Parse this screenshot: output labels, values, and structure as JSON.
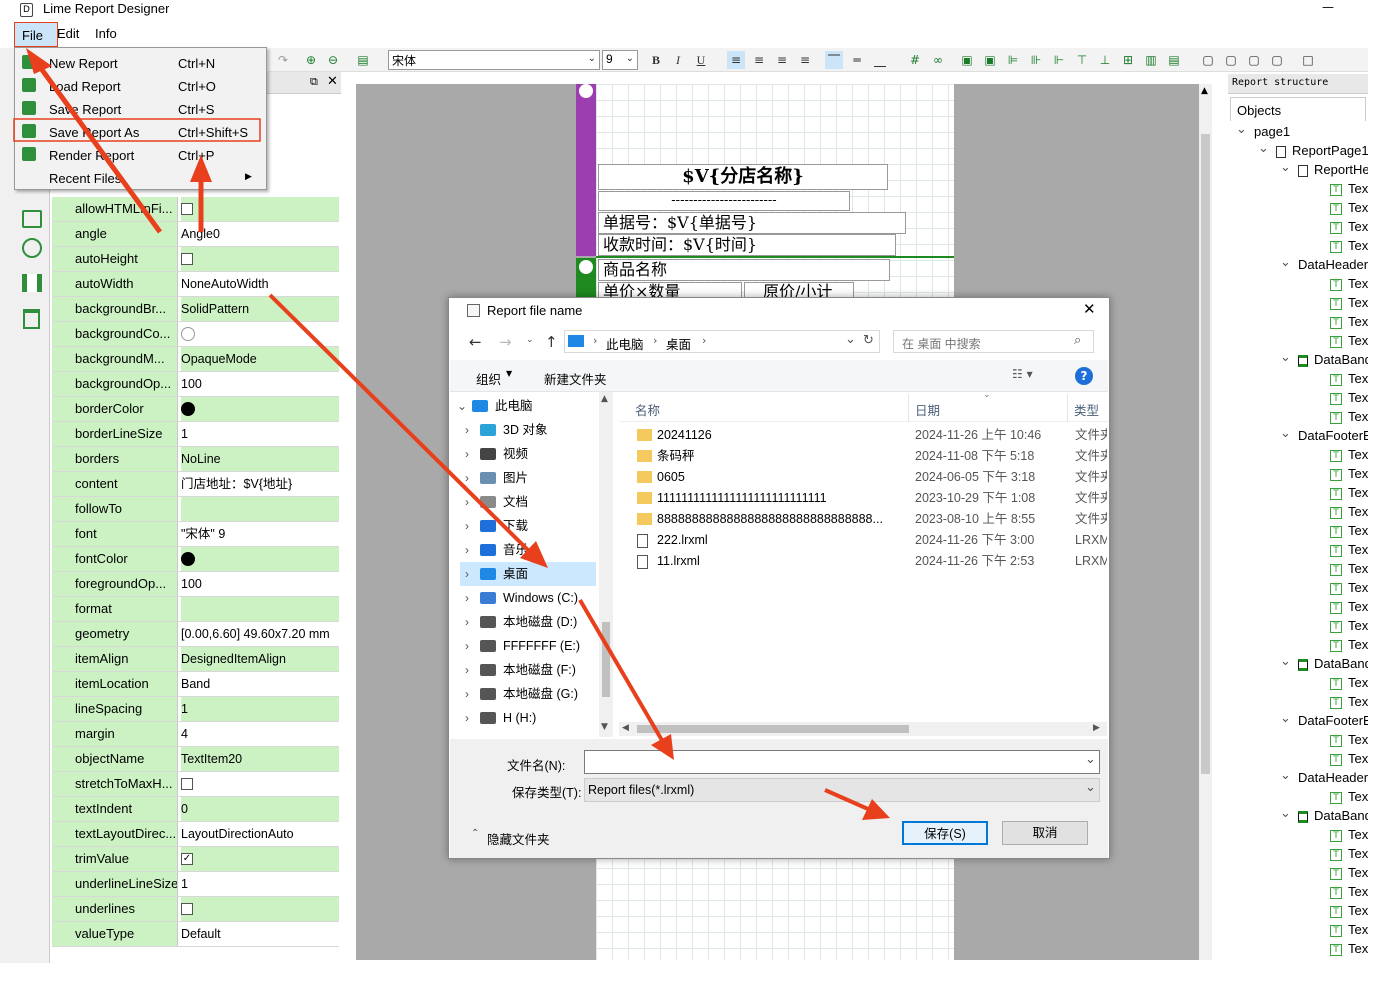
{
  "window": {
    "title": "Lime Report Designer",
    "close_glyph": "✕",
    "min_glyph": "—"
  },
  "menubar": {
    "items": [
      "File",
      "Edit",
      "Info"
    ]
  },
  "toolbar": {
    "font_family": "宋体",
    "font_size": "9",
    "bold": "B",
    "italic": "I",
    "underline": "U"
  },
  "file_menu": {
    "items": [
      {
        "label": "New Report",
        "shortcut": "Ctrl+N"
      },
      {
        "label": "Load Report",
        "shortcut": "Ctrl+O"
      },
      {
        "label": "Save Report",
        "shortcut": "Ctrl+S"
      },
      {
        "label": "Save Report As",
        "shortcut": "Ctrl+Shift+S"
      },
      {
        "label": "Render Report",
        "shortcut": "Ctrl+P"
      },
      {
        "label": "Recent Files",
        "shortcut": ""
      }
    ]
  },
  "properties": [
    {
      "name": "allowHTMLInFi...",
      "value": "",
      "kind": "check",
      "checked": false
    },
    {
      "name": "angle",
      "value": "Angle0",
      "kind": "text"
    },
    {
      "name": "autoHeight",
      "value": "",
      "kind": "check",
      "checked": false
    },
    {
      "name": "autoWidth",
      "value": "NoneAutoWidth",
      "kind": "text"
    },
    {
      "name": "backgroundBr...",
      "value": "SolidPattern",
      "kind": "text"
    },
    {
      "name": "backgroundCo...",
      "value": "",
      "kind": "circle",
      "color": "#ffffff"
    },
    {
      "name": "backgroundM...",
      "value": "OpaqueMode",
      "kind": "text"
    },
    {
      "name": "backgroundOp...",
      "value": "100",
      "kind": "text"
    },
    {
      "name": "borderColor",
      "value": "",
      "kind": "circle",
      "color": "#000000"
    },
    {
      "name": "borderLineSize",
      "value": "1",
      "kind": "text"
    },
    {
      "name": "borders",
      "value": "NoLine",
      "kind": "text",
      "expandable": true
    },
    {
      "name": "content",
      "value": "门店地址：$V{地址}",
      "kind": "text"
    },
    {
      "name": "followTo",
      "value": "",
      "kind": "text"
    },
    {
      "name": "font",
      "value": "\"宋体\" 9",
      "kind": "text",
      "expandable": true
    },
    {
      "name": "fontColor",
      "value": "",
      "kind": "circle",
      "color": "#000000"
    },
    {
      "name": "foregroundOp...",
      "value": "100",
      "kind": "text"
    },
    {
      "name": "format",
      "value": "",
      "kind": "text"
    },
    {
      "name": "geometry",
      "value": "[0.00,6.60] 49.60x7.20 mm",
      "kind": "text",
      "expandable": true
    },
    {
      "name": "itemAlign",
      "value": "DesignedItemAlign",
      "kind": "text"
    },
    {
      "name": "itemLocation",
      "value": "Band",
      "kind": "text"
    },
    {
      "name": "lineSpacing",
      "value": "1",
      "kind": "text"
    },
    {
      "name": "margin",
      "value": "4",
      "kind": "text"
    },
    {
      "name": "objectName",
      "value": "TextItem20",
      "kind": "text"
    },
    {
      "name": "stretchToMaxH...",
      "value": "",
      "kind": "check",
      "checked": false
    },
    {
      "name": "textIndent",
      "value": "0",
      "kind": "text"
    },
    {
      "name": "textLayoutDirec...",
      "value": "LayoutDirectionAuto",
      "kind": "text"
    },
    {
      "name": "trimValue",
      "value": "",
      "kind": "check",
      "checked": true
    },
    {
      "name": "underlineLineSize",
      "value": "1",
      "kind": "text"
    },
    {
      "name": "underlines",
      "value": "",
      "kind": "check",
      "checked": false
    },
    {
      "name": "valueType",
      "value": "Default",
      "kind": "text"
    }
  ],
  "report_page": {
    "title_field": "$V{分店名称}",
    "dashes": "------------------------",
    "order_no": "单据号：$V{单据号}",
    "pay_time": "收款时间：$V{时间}",
    "product_name": "商品名称",
    "unit_price": "单价×数量",
    "orig_price": "原价/小计"
  },
  "structure": {
    "header": "Report structure",
    "objects_label": "Objects",
    "nodes": [
      {
        "label": "page1",
        "level": 0,
        "arrow": true,
        "icon": "none"
      },
      {
        "label": "ReportPage1",
        "level": 1,
        "arrow": true,
        "icon": "page"
      },
      {
        "label": "ReportHeader",
        "level": 2,
        "arrow": true,
        "icon": "page"
      },
      {
        "label": "TextItem",
        "level": 3,
        "icon": "T"
      },
      {
        "label": "TextItem",
        "level": 3,
        "icon": "T"
      },
      {
        "label": "TextItem",
        "level": 3,
        "icon": "T"
      },
      {
        "label": "TextItem",
        "level": 3,
        "icon": "T"
      },
      {
        "label": "DataHeaderBand",
        "level": 2,
        "arrow": true,
        "icon": "none"
      },
      {
        "label": "TextItem",
        "level": 3,
        "icon": "T"
      },
      {
        "label": "TextItem",
        "level": 3,
        "icon": "T"
      },
      {
        "label": "TextItem",
        "level": 3,
        "icon": "T"
      },
      {
        "label": "TextItem",
        "level": 3,
        "icon": "T"
      },
      {
        "label": "DataBand",
        "level": 2,
        "arrow": true,
        "icon": "band"
      },
      {
        "label": "TextItem",
        "level": 3,
        "icon": "T"
      },
      {
        "label": "TextItem",
        "level": 3,
        "icon": "T"
      },
      {
        "label": "TextItem",
        "level": 3,
        "icon": "T"
      },
      {
        "label": "DataFooterBand",
        "level": 2,
        "arrow": true,
        "icon": "none"
      },
      {
        "label": "TextItem",
        "level": 3,
        "icon": "T"
      },
      {
        "label": "TextItem",
        "level": 3,
        "icon": "T"
      },
      {
        "label": "TextItem",
        "level": 3,
        "icon": "T"
      },
      {
        "label": "TextItem",
        "level": 3,
        "icon": "T"
      },
      {
        "label": "TextItem",
        "level": 3,
        "icon": "T"
      },
      {
        "label": "TextItem",
        "level": 3,
        "icon": "T"
      },
      {
        "label": "TextItem",
        "level": 3,
        "icon": "T"
      },
      {
        "label": "TextItem",
        "level": 3,
        "icon": "T"
      },
      {
        "label": "TextItem",
        "level": 3,
        "icon": "T"
      },
      {
        "label": "TextItem",
        "level": 3,
        "icon": "T"
      },
      {
        "label": "TextItem",
        "level": 3,
        "icon": "T"
      },
      {
        "label": "DataBand",
        "level": 2,
        "arrow": true,
        "icon": "band"
      },
      {
        "label": "TextItem",
        "level": 3,
        "icon": "T"
      },
      {
        "label": "TextItem",
        "level": 3,
        "icon": "T"
      },
      {
        "label": "DataFooterBand",
        "level": 2,
        "arrow": true,
        "icon": "none"
      },
      {
        "label": "TextItem",
        "level": 3,
        "icon": "T"
      },
      {
        "label": "TextItem",
        "level": 3,
        "icon": "T"
      },
      {
        "label": "DataHeaderBand",
        "level": 2,
        "arrow": true,
        "icon": "none"
      },
      {
        "label": "TextItem",
        "level": 3,
        "icon": "T"
      },
      {
        "label": "DataBand",
        "level": 2,
        "arrow": true,
        "icon": "band"
      },
      {
        "label": "TextItem",
        "level": 3,
        "icon": "T"
      },
      {
        "label": "TextItem",
        "level": 3,
        "icon": "T"
      },
      {
        "label": "TextItem",
        "level": 3,
        "icon": "T"
      },
      {
        "label": "TextItem",
        "level": 3,
        "icon": "T"
      },
      {
        "label": "TextItem",
        "level": 3,
        "icon": "T"
      },
      {
        "label": "TextItem",
        "level": 3,
        "icon": "T"
      },
      {
        "label": "TextItem",
        "level": 3,
        "icon": "T"
      }
    ]
  },
  "dialog": {
    "title": "Report file name",
    "breadcrumb": [
      "此电脑",
      "桌面"
    ],
    "search_placeholder": "在 桌面 中搜索",
    "organize": "组织",
    "new_folder": "新建文件夹",
    "help": "?",
    "columns": {
      "name": "名称",
      "date": "日期",
      "type": "类型"
    },
    "nav": [
      {
        "label": "此电脑",
        "indent": 0,
        "expanded": true,
        "color": "#1e88e5"
      },
      {
        "label": "3D 对象",
        "indent": 1,
        "color": "#2aa3d8"
      },
      {
        "label": "视频",
        "indent": 1,
        "color": "#444444"
      },
      {
        "label": "图片",
        "indent": 1,
        "color": "#6a8fb0"
      },
      {
        "label": "文档",
        "indent": 1,
        "color": "#8a8a8a"
      },
      {
        "label": "下载",
        "indent": 1,
        "color": "#1e6fd9"
      },
      {
        "label": "音乐",
        "indent": 1,
        "color": "#1e6fd9"
      },
      {
        "label": "桌面",
        "indent": 1,
        "color": "#1e88e5",
        "selected": true
      },
      {
        "label": "Windows  (C:)",
        "indent": 1,
        "color": "#3a7bd5"
      },
      {
        "label": "本地磁盘 (D:)",
        "indent": 1,
        "color": "#555555"
      },
      {
        "label": "FFFFFFF (E:)",
        "indent": 1,
        "color": "#555555"
      },
      {
        "label": "本地磁盘 (F:)",
        "indent": 1,
        "color": "#555555"
      },
      {
        "label": "本地磁盘 (G:)",
        "indent": 1,
        "color": "#555555"
      },
      {
        "label": "H (H:)",
        "indent": 1,
        "color": "#555555"
      }
    ],
    "files": [
      {
        "name": "20241126",
        "date": "2024-11-26 上午 10:46",
        "type": "文件夹",
        "kind": "folder"
      },
      {
        "name": "条码秤",
        "date": "2024-11-08 下午 5:18",
        "type": "文件夹",
        "kind": "folder"
      },
      {
        "name": "0605",
        "date": "2024-06-05 下午 3:18",
        "type": "文件夹",
        "kind": "folder"
      },
      {
        "name": "1111111111111111111111111111",
        "date": "2023-10-29 下午 1:08",
        "type": "文件夹",
        "kind": "folder"
      },
      {
        "name": "8888888888888888888888888888888...",
        "date": "2023-08-10 上午 8:55",
        "type": "文件夹",
        "kind": "folder"
      },
      {
        "name": "222.lrxml",
        "date": "2024-11-26 下午 3:00",
        "type": "LRXML",
        "kind": "file"
      },
      {
        "name": "11.lrxml",
        "date": "2024-11-26 下午 2:53",
        "type": "LRXML",
        "kind": "file"
      }
    ],
    "filename_label": "文件名(N):",
    "filename_value": "",
    "filetype_label": "保存类型(T):",
    "filetype_value": "Report files(*.lrxml)",
    "hide_folders": "隐藏文件夹",
    "save_button": "保存(S)",
    "cancel_button": "取消"
  },
  "colors": {
    "highlight_red": "#e8401c",
    "prop_green": "#ccf2c4",
    "band_purple": "#9b3fb0",
    "band_green": "#1f8a1f"
  }
}
